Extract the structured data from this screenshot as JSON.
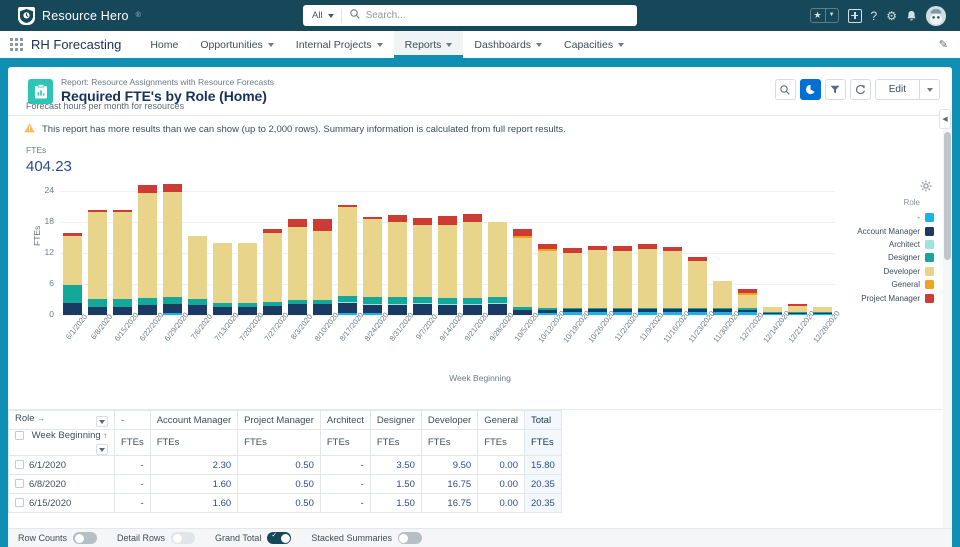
{
  "global_header": {
    "brand_name": "Resource Hero",
    "brand_tm": "®",
    "search": {
      "scope": "All",
      "placeholder": "Search...",
      "value": ""
    },
    "icons": [
      {
        "name": "favorites-star-icon",
        "glyph": "★"
      },
      {
        "name": "favorites-caret-icon",
        "glyph": "▾"
      },
      {
        "name": "add-icon",
        "glyph": "+"
      },
      {
        "name": "help-icon",
        "glyph": "?"
      },
      {
        "name": "setup-gear-icon",
        "glyph": "⚙"
      },
      {
        "name": "notifications-bell-icon",
        "glyph": "🔔"
      },
      {
        "name": "user-avatar",
        "glyph": ""
      }
    ]
  },
  "app_nav": {
    "app_name": "RH Forecasting",
    "items": [
      {
        "label": "Home",
        "has_caret": false,
        "active": false
      },
      {
        "label": "Opportunities",
        "has_caret": true,
        "active": false
      },
      {
        "label": "Internal Projects",
        "has_caret": true,
        "active": false
      },
      {
        "label": "Reports",
        "has_caret": true,
        "active": true
      },
      {
        "label": "Dashboards",
        "has_caret": true,
        "active": false
      },
      {
        "label": "Capacities",
        "has_caret": true,
        "active": false
      }
    ],
    "edit_pencil_icon": "✎"
  },
  "report": {
    "eyebrow": "Report: Resource Assignments with Resource Forecasts",
    "title": "Required FTE's by Role (Home)",
    "subtitle": "Forecast hours per month for resources",
    "actions": [
      {
        "name": "search-report-button",
        "glyph": "⚲"
      },
      {
        "name": "toggle-chart-button",
        "glyph": "◔",
        "primary": true
      },
      {
        "name": "filter-button",
        "glyph": "▼"
      },
      {
        "name": "refresh-button",
        "glyph": "↻"
      }
    ],
    "edit_label": "Edit",
    "edit_caret": "▾"
  },
  "notice": {
    "icon": "warning-triangle-icon",
    "text": "This report has more results than we can show (up to 2,000 rows). Summary information is calculated from full report results."
  },
  "summary": {
    "label": "FTEs",
    "value": "404.23"
  },
  "chart_panel": {
    "gear_icon": "gear-icon",
    "gear_glyph": "⚙"
  },
  "chart_data": {
    "type": "bar",
    "stacked": true,
    "title": "",
    "xlabel": "Week Beginning",
    "ylabel": "FTEs",
    "ylim": [
      0,
      24
    ],
    "yticks": [
      0,
      6,
      12,
      18,
      24
    ],
    "grid": true,
    "legend_title": "Role",
    "legend_position": "right",
    "categories": [
      "6/1/2020",
      "6/8/2020",
      "6/15/2020",
      "6/22/2020",
      "6/29/2020",
      "7/6/2020",
      "7/13/2020",
      "7/20/2020",
      "7/27/2020",
      "8/3/2020",
      "8/10/2020",
      "8/17/2020",
      "8/24/2020",
      "8/31/2020",
      "9/7/2020",
      "9/14/2020",
      "9/21/2020",
      "9/28/2020",
      "10/5/2020",
      "10/12/2020",
      "10/19/2020",
      "10/26/2020",
      "11/2/2020",
      "11/9/2020",
      "11/16/2020",
      "11/23/2020",
      "11/30/2020",
      "12/7/2020",
      "12/14/2020",
      "12/21/2020",
      "12/28/2020"
    ],
    "series": [
      {
        "name": "-",
        "color": "#1ab2e8",
        "values": [
          0,
          0,
          0,
          0,
          0.35,
          0,
          0,
          0,
          0,
          0,
          0,
          0.3,
          0.3,
          0,
          0,
          0,
          0,
          0,
          0,
          0.35,
          0.55,
          0.55,
          0.55,
          0.55,
          0.55,
          0.55,
          0.55,
          0.5,
          0.2,
          0.2,
          0.2
        ]
      },
      {
        "name": "Account Manager",
        "color": "#1b3a63",
        "values": [
          2.3,
          1.6,
          1.6,
          1.9,
          1.85,
          1.85,
          1.55,
          1.55,
          1.75,
          2.05,
          2.05,
          1.95,
          1.6,
          1.85,
          2.05,
          1.95,
          1.95,
          2.05,
          0.95,
          0.7,
          0.6,
          0.6,
          0.6,
          0.6,
          0.6,
          0.6,
          0.6,
          0.5,
          0.18,
          0.18,
          0.18
        ]
      },
      {
        "name": "Architect",
        "color": "#9fe3e0",
        "values": [
          0,
          0,
          0,
          0,
          0,
          0,
          0,
          0,
          0,
          0,
          0,
          0.25,
          0.25,
          0.25,
          0.25,
          0.25,
          0.25,
          0.25,
          0,
          0,
          0,
          0,
          0,
          0,
          0,
          0,
          0,
          0,
          0,
          0,
          0
        ]
      },
      {
        "name": "Designer",
        "color": "#14a89b",
        "values": [
          3.5,
          1.5,
          1.5,
          1.35,
          1.35,
          1.2,
          0.7,
          0.7,
          0.7,
          0.95,
          0.95,
          1.25,
          1.35,
          1.35,
          1.2,
          1.15,
          1.15,
          1.15,
          0.55,
          0.35,
          0.3,
          0.3,
          0.3,
          0.3,
          0.3,
          0.3,
          0.3,
          0.35,
          0.15,
          0.15,
          0.15
        ]
      },
      {
        "name": "Developer",
        "color": "#e8d48a",
        "values": [
          9.5,
          16.75,
          16.75,
          20.4,
          20.2,
          12.3,
          11.7,
          11.7,
          13.4,
          14.1,
          13.35,
          17.1,
          15.0,
          14.6,
          14.0,
          14.1,
          14.6,
          14.5,
          13.4,
          11.0,
          10.6,
          11.1,
          11.0,
          11.3,
          11.0,
          9.0,
          5.1,
          2.6,
          1.1,
          1.3,
          1.0
        ]
      },
      {
        "name": "General",
        "color": "#f0a31e",
        "values": [
          0.0,
          0.0,
          0.0,
          0.0,
          0.0,
          0.0,
          0.0,
          0.0,
          0.0,
          0.0,
          0.0,
          0.0,
          0.0,
          0.0,
          0.0,
          0.0,
          0.0,
          0.0,
          0.45,
          0.35,
          0.0,
          0.0,
          0.0,
          0.0,
          0.0,
          0.0,
          0.0,
          0.3,
          0.0,
          0.0,
          0.0
        ]
      },
      {
        "name": "Project Manager",
        "color": "#cc3b34",
        "values": [
          0.5,
          0.5,
          0.5,
          1.55,
          1.55,
          0.0,
          0.0,
          0.0,
          0.9,
          1.4,
          2.3,
          0.5,
          0.4,
          1.25,
          1.25,
          1.65,
          1.7,
          0.0,
          1.3,
          1.0,
          0.85,
          0.9,
          0.85,
          1.0,
          0.8,
          0.8,
          0.0,
          0.7,
          0.0,
          0.3,
          0.0
        ]
      }
    ]
  },
  "table": {
    "corner_row1_label": "Role",
    "corner_row1_arrow": "→",
    "corner_row2_label": "Week Beginning",
    "corner_row2_arrow": "↑",
    "group_headers": [
      "-",
      "Account Manager",
      "Project Manager",
      "Architect",
      "Designer",
      "Developer",
      "General",
      "Total"
    ],
    "measure_label": "FTEs",
    "rows": [
      {
        "week": "6/1/2020",
        "values": [
          "-",
          "2.30",
          "0.50",
          "-",
          "3.50",
          "9.50",
          "0.00"
        ],
        "total": "15.80"
      },
      {
        "week": "6/8/2020",
        "values": [
          "-",
          "1.60",
          "0.50",
          "-",
          "1.50",
          "16.75",
          "0.00"
        ],
        "total": "20.35"
      },
      {
        "week": "6/15/2020",
        "values": [
          "-",
          "1.60",
          "0.50",
          "-",
          "1.50",
          "16.75",
          "0.00"
        ],
        "total": "20.35"
      }
    ]
  },
  "footer_toggles": [
    {
      "label": "Row Counts",
      "on": false,
      "style": "grey"
    },
    {
      "label": "Detail Rows",
      "on": false,
      "style": "light"
    },
    {
      "label": "Grand Total",
      "on": true,
      "style": "dark"
    },
    {
      "label": "Stacked Summaries",
      "on": false,
      "style": "grey"
    }
  ],
  "colors": {
    "brand_header": "#16485a",
    "accent_teal": "#0e8fb3",
    "primary_blue": "#0070d2",
    "link_blue": "#2a4b8d"
  }
}
